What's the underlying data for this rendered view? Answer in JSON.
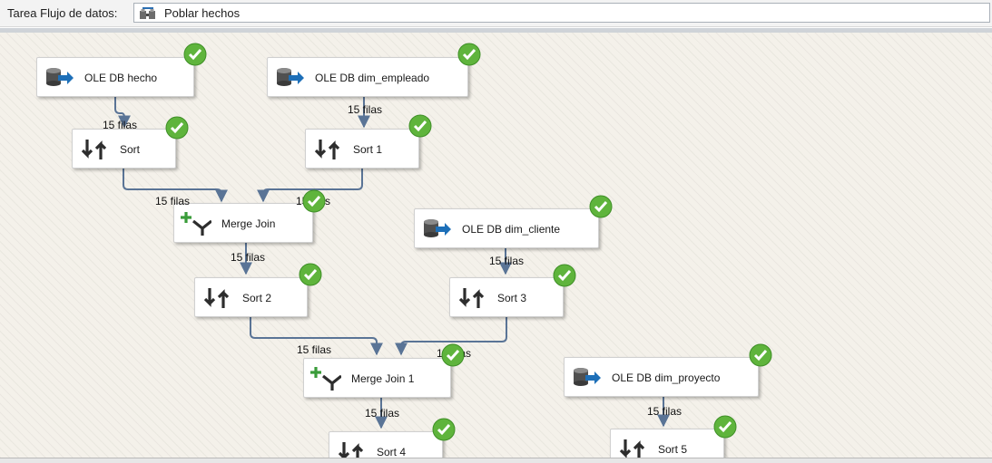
{
  "header": {
    "task_label": "Tarea Flujo de datos:",
    "task_value": "Poblar hechos",
    "task_icon": "data-flow-icon"
  },
  "components": {
    "ole_hecho": {
      "label": "OLE DB hecho",
      "icon": "ole-db-source-icon",
      "status": "success"
    },
    "ole_empleado": {
      "label": "OLE DB dim_empleado",
      "icon": "ole-db-source-icon",
      "status": "success"
    },
    "sort": {
      "label": "Sort",
      "icon": "sort-icon",
      "status": "success"
    },
    "sort1": {
      "label": "Sort 1",
      "icon": "sort-icon",
      "status": "success"
    },
    "merge_join": {
      "label": "Merge Join",
      "icon": "merge-join-icon",
      "status": "success"
    },
    "ole_cliente": {
      "label": "OLE DB dim_cliente",
      "icon": "ole-db-source-icon",
      "status": "success"
    },
    "sort2": {
      "label": "Sort 2",
      "icon": "sort-icon",
      "status": "success"
    },
    "sort3": {
      "label": "Sort 3",
      "icon": "sort-icon",
      "status": "success"
    },
    "merge_join1": {
      "label": "Merge Join 1",
      "icon": "merge-join-icon",
      "status": "success"
    },
    "ole_proyecto": {
      "label": "OLE DB dim_proyecto",
      "icon": "ole-db-source-icon",
      "status": "success"
    },
    "sort4": {
      "label": "Sort 4",
      "icon": "sort-icon",
      "status": "success"
    },
    "sort5": {
      "label": "Sort 5",
      "icon": "sort-icon",
      "status": "success"
    }
  },
  "paths": {
    "hecho_to_sort": "15 filas",
    "empleado_to_sort1": "15 filas",
    "sort_to_merge": "15 filas",
    "sort1_to_merge": "15 filas",
    "merge_to_sort2": "15 filas",
    "cliente_to_sort3": "15 filas",
    "sort2_to_merge1": "15 filas",
    "sort3_to_merge1": "15 filas",
    "merge1_to_sort4": "15 filas",
    "proyecto_to_sort5": "15 filas"
  },
  "colors": {
    "wire": "#5a7496",
    "check": "#5fb43c",
    "canvas": "#f4f1ea"
  }
}
